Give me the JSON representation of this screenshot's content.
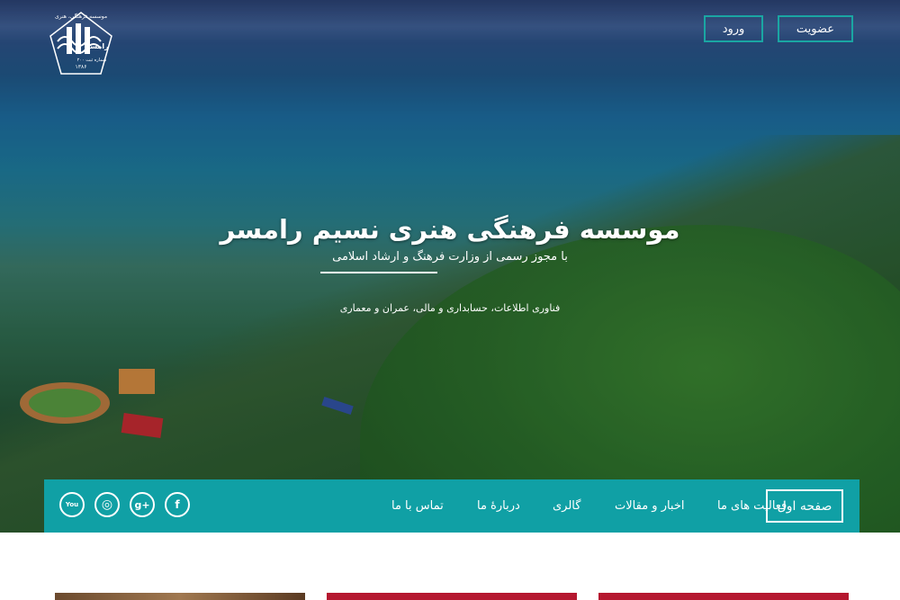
{
  "header": {
    "logo": {
      "org_name": "موسسه فرهنگی، هنری",
      "city": "رامسر",
      "reg_number": "شماره ثبت ۲۰۰",
      "year": "۱۳۸۶",
      "icon": "logo-emblem-icon"
    },
    "register_label": "عضویت",
    "login_label": "ورود"
  },
  "hero": {
    "title": "موسسه فرهنگی هنری نسیم رامسر",
    "subtitle": "با مجوز رسمی از وزارت فرهنگ و ارشاد اسلامی",
    "tagline": "فناوری اطلاعات، حسابداری و مالی، عمران و معماری"
  },
  "nav": {
    "home": "صفحه اول",
    "items": [
      {
        "label": "فعالیت های ما"
      },
      {
        "label": "اخبار و مقالات"
      },
      {
        "label": "گالری"
      },
      {
        "label": "دربارهٔ ما"
      },
      {
        "label": "تماس با ما"
      }
    ],
    "social": [
      {
        "icon": "facebook-icon",
        "glyph": "f"
      },
      {
        "icon": "google-plus-icon",
        "glyph": "g+"
      },
      {
        "icon": "instagram-icon",
        "glyph": "◎"
      },
      {
        "icon": "youtube-icon",
        "glyph": "You"
      }
    ]
  },
  "colors": {
    "accent": "#10a0a5",
    "button_border": "#1aa6a3",
    "card_red": "#b5172f"
  }
}
